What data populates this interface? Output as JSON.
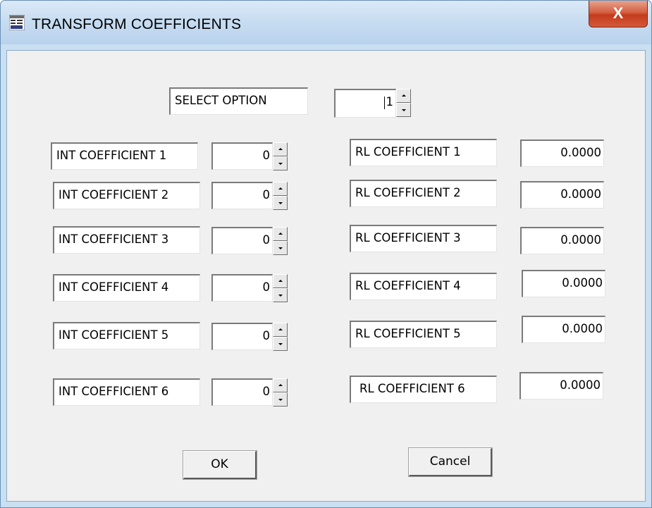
{
  "window": {
    "title": "TRANSFORM COEFFICIENTS",
    "close_glyph": "X",
    "icon": "app-icon"
  },
  "select_option": {
    "label": "SELECT OPTION",
    "value": "1"
  },
  "int_coefficients": [
    {
      "label": "INT COEFFICIENT 1",
      "value": "0"
    },
    {
      "label": "INT COEFFICIENT 2",
      "value": "0"
    },
    {
      "label": "INT COEFFICIENT 3",
      "value": "0"
    },
    {
      "label": "INT COEFFICIENT 4",
      "value": "0"
    },
    {
      "label": "INT COEFFICIENT 5",
      "value": "0"
    },
    {
      "label": "INT COEFFICIENT 6",
      "value": "0"
    }
  ],
  "rl_coefficients": [
    {
      "label": "RL COEFFICIENT 1",
      "value": "0.0000"
    },
    {
      "label": "RL COEFFICIENT 2",
      "value": "0.0000"
    },
    {
      "label": "RL COEFFICIENT 3",
      "value": "0.0000"
    },
    {
      "label": "RL COEFFICIENT 4",
      "value": "0.0000"
    },
    {
      "label": "RL COEFFICIENT 5",
      "value": "0.0000"
    },
    {
      "label": "RL COEFFICIENT 6",
      "value": "0.0000"
    }
  ],
  "buttons": {
    "ok": "OK",
    "cancel": "Cancel"
  }
}
